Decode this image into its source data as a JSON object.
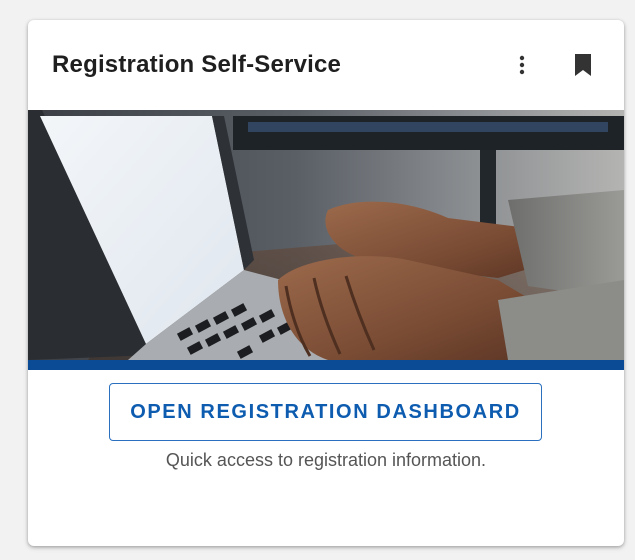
{
  "card": {
    "title": "Registration Self-Service",
    "menu_icon": "more-vert-icon",
    "bookmark_icon": "bookmark-icon",
    "image_subject": "hands-typing-on-laptop",
    "accent_color": "#0b4a95",
    "button_label": "OPEN REGISTRATION DASHBOARD",
    "button_color": "#0d5cb0",
    "description": "Quick access to registration information."
  }
}
